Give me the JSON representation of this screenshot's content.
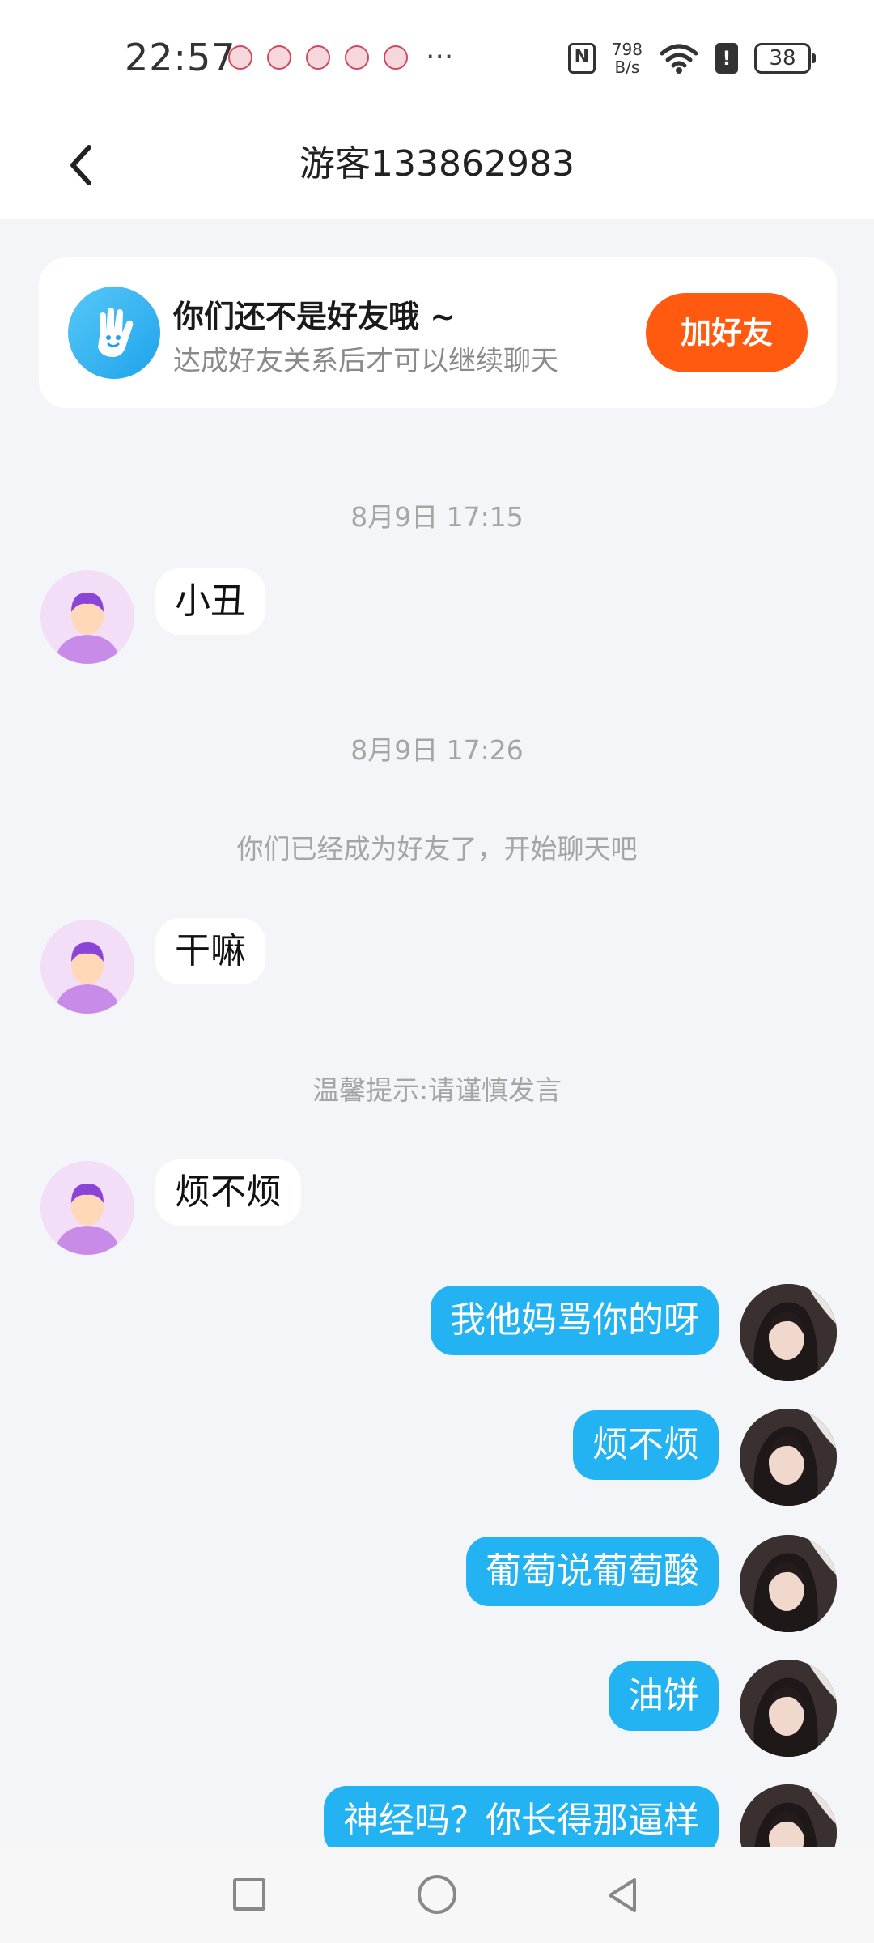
{
  "status_bar": {
    "time": "22:57",
    "more": "···",
    "net_speed_value": "798",
    "net_speed_unit": "B/s",
    "battery": "38",
    "nfc": "N",
    "alert": "!"
  },
  "header": {
    "title": "游客133862983"
  },
  "friend_banner": {
    "title": "你们还不是好友哦 ~",
    "subtitle": "达成好友关系后才可以继续聊天",
    "add_button": "加好友"
  },
  "messages": [
    {
      "type": "timestamp",
      "text": "8月9日 17:15"
    },
    {
      "type": "incoming",
      "text": "小丑"
    },
    {
      "type": "timestamp",
      "text": "8月9日 17:26"
    },
    {
      "type": "system",
      "text": "你们已经成为好友了，开始聊天吧"
    },
    {
      "type": "incoming",
      "text": "干嘛"
    },
    {
      "type": "system",
      "text": "温馨提示:请谨慎发言"
    },
    {
      "type": "incoming",
      "text": "烦不烦"
    },
    {
      "type": "outgoing",
      "text": "我他妈骂你的呀"
    },
    {
      "type": "outgoing",
      "text": "烦不烦"
    },
    {
      "type": "outgoing",
      "text": "葡萄说葡萄酸"
    },
    {
      "type": "outgoing",
      "text": "油饼"
    },
    {
      "type": "outgoing",
      "text": "神经吗？你长得那逼样"
    }
  ],
  "colors": {
    "page_bg": "#f3f5f9",
    "outgoing_bubble": "#23b2f2",
    "add_button": "#ff5a0f"
  }
}
